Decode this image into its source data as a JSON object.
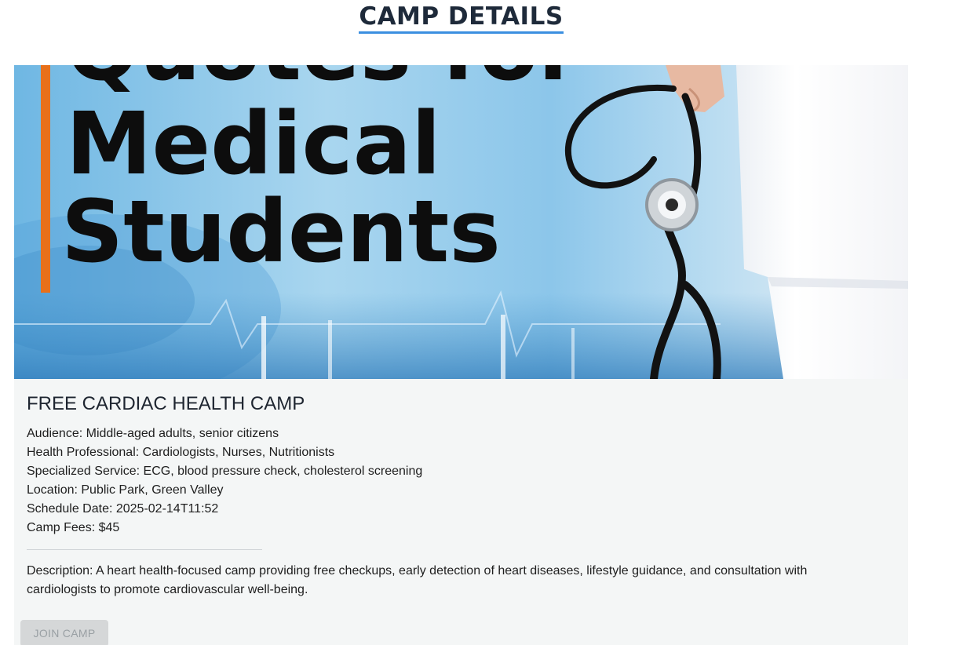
{
  "page": {
    "title": "CAMP DETAILS"
  },
  "banner": {
    "image_alt": "Quotes for Medical Students banner with doctor holding stethoscope",
    "text_line1": "Quotes for",
    "text_line2": "Medical",
    "text_line3": "Students"
  },
  "camp": {
    "name": "FREE CARDIAC HEALTH CAMP",
    "details": [
      "Audience: Middle-aged adults, senior citizens",
      "Health Professional: Cardiologists, Nurses, Nutritionists",
      "Specialized Service: ECG, blood pressure check, cholesterol screening",
      "Location: Public Park, Green Valley",
      "Schedule Date: 2025-02-14T11:52",
      "Camp Fees: $45"
    ],
    "description": "Description: A heart health-focused camp providing free checkups, early detection of heart diseases, lifestyle guidance, and consultation with cardiologists to promote cardiovascular well-being."
  },
  "actions": {
    "join_label": "JOIN CAMP"
  },
  "colors": {
    "title_underline": "#3b8fe0",
    "card_background": "#f4f6f6",
    "button_disabled_bg": "#d5d7d8",
    "banner_accent": "#e8701a"
  }
}
